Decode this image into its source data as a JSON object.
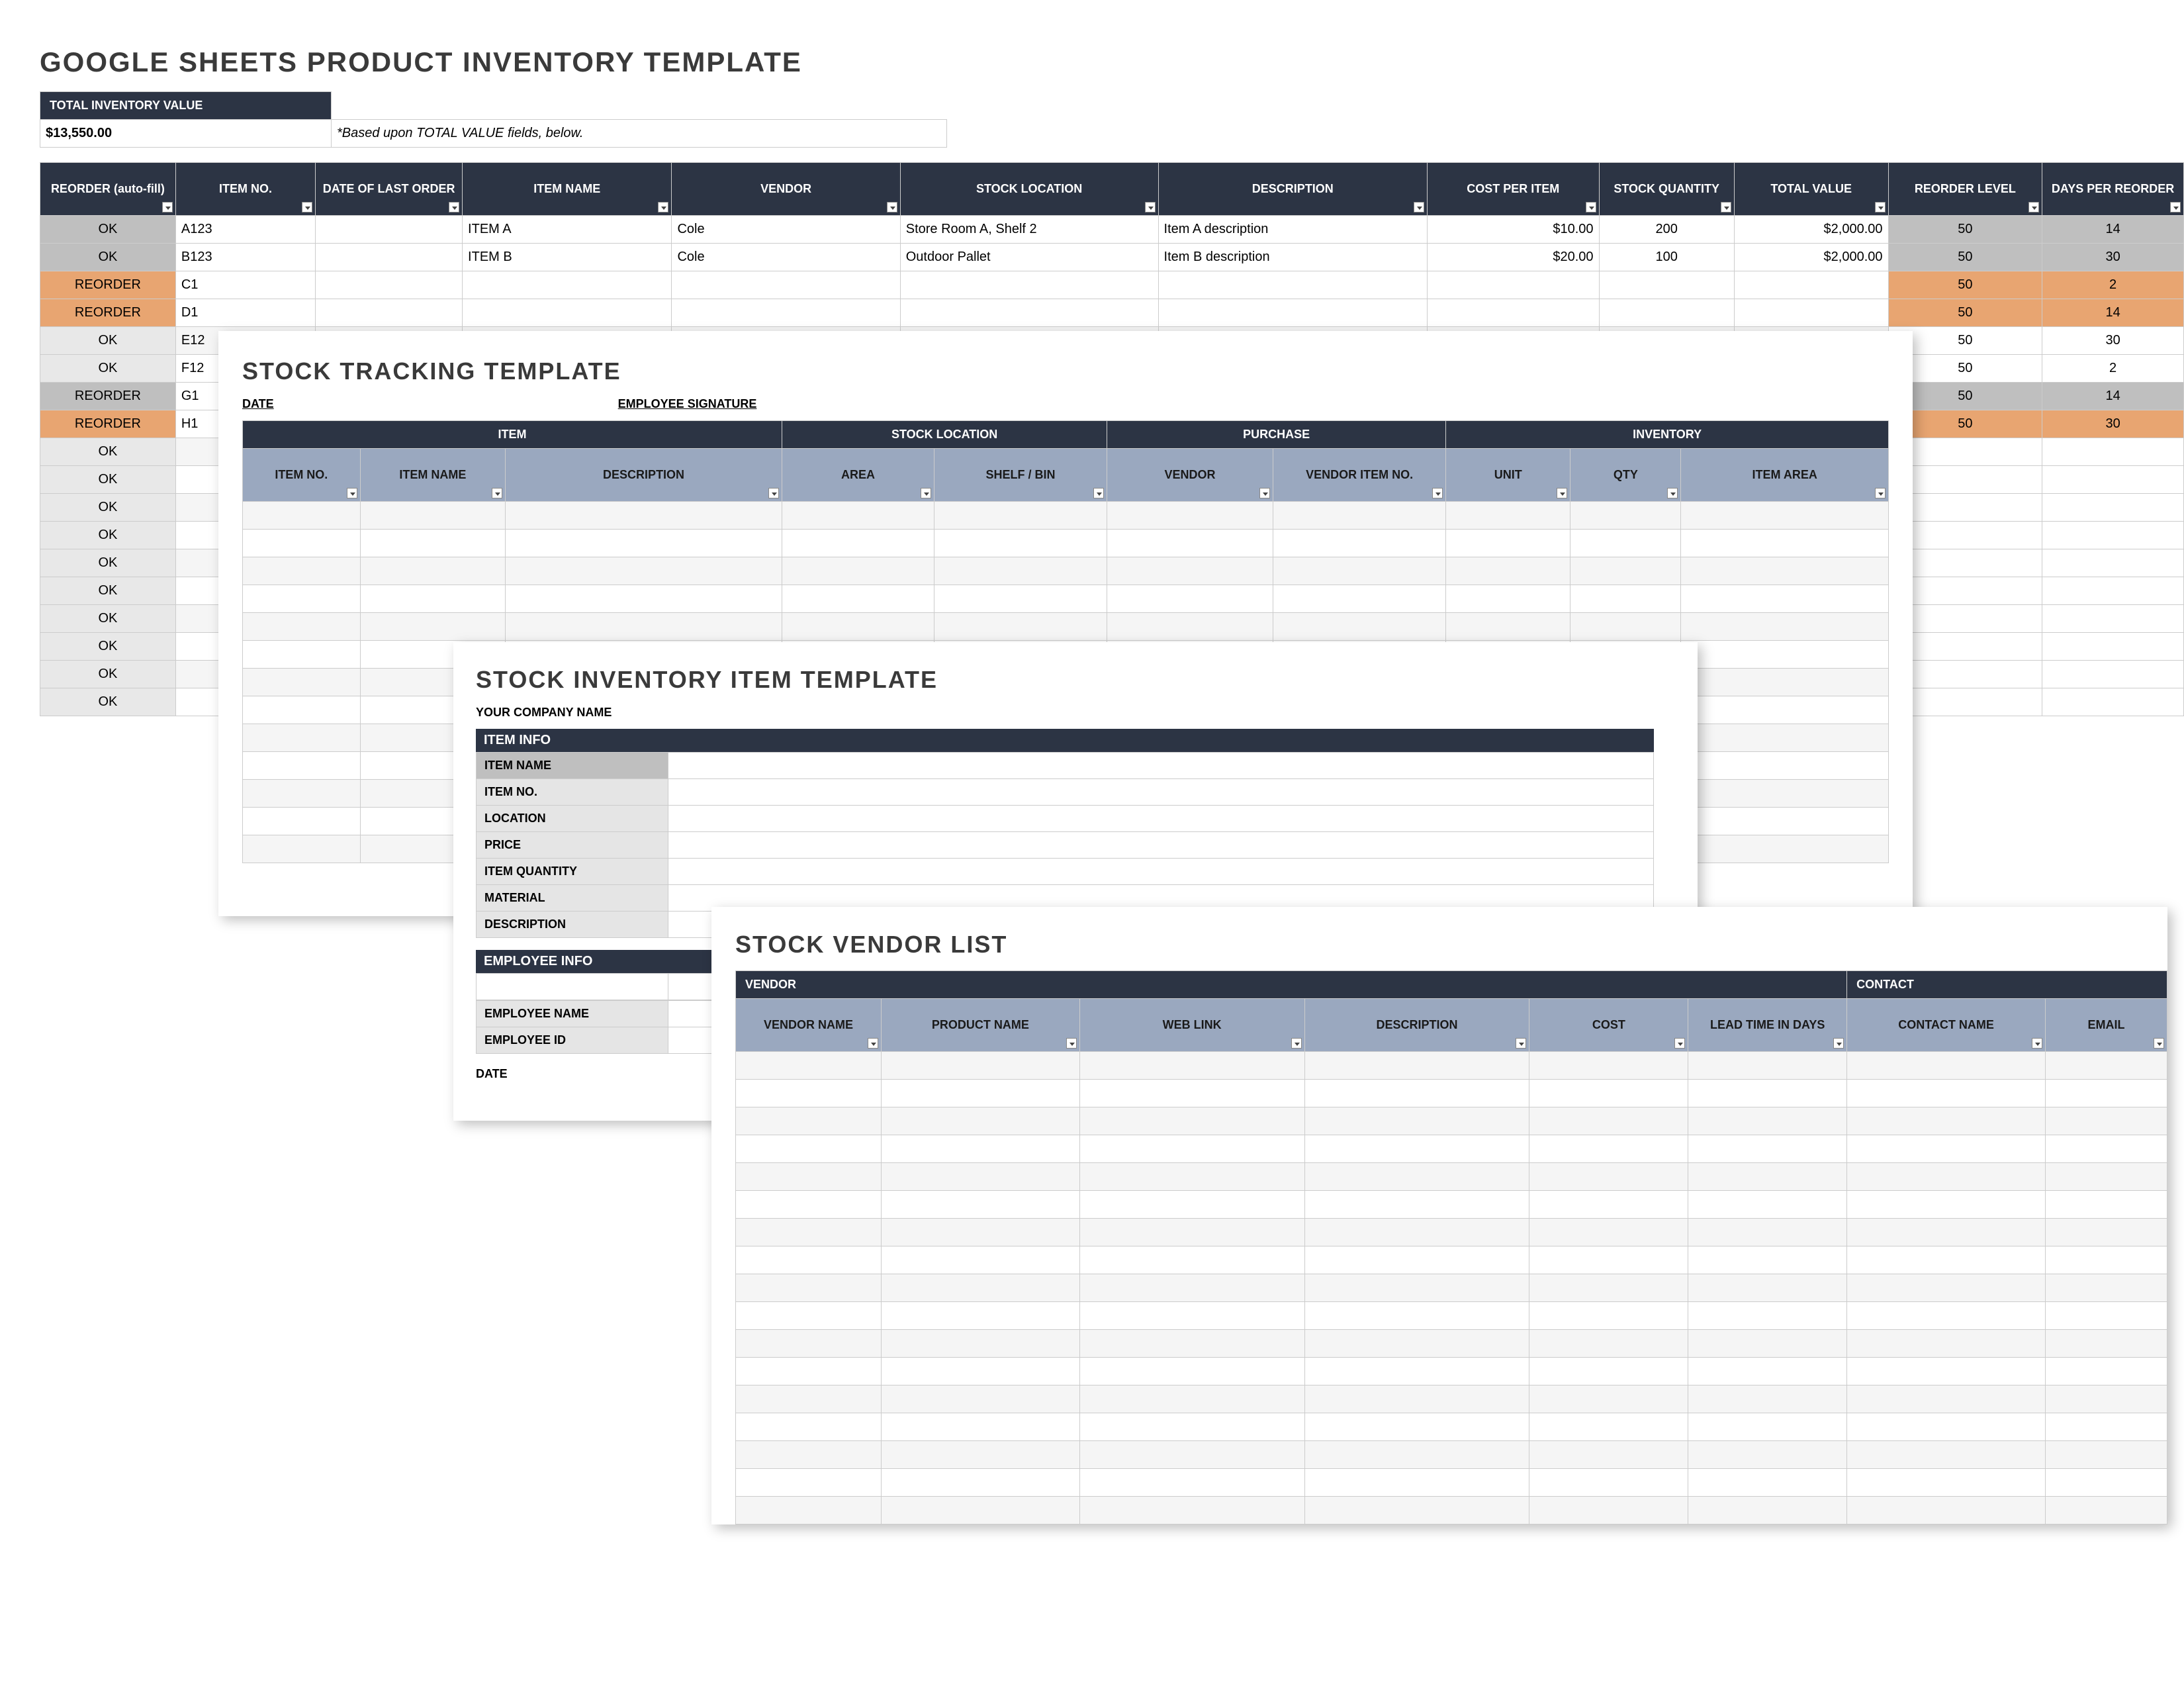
{
  "main": {
    "title": "GOOGLE SHEETS PRODUCT INVENTORY TEMPLATE",
    "inventory_label": "TOTAL INVENTORY VALUE",
    "inventory_value": "$13,550.00",
    "inventory_note": "*Based upon TOTAL VALUE fields, below.",
    "headers": [
      "REORDER (auto-fill)",
      "ITEM NO.",
      "DATE OF LAST ORDER",
      "ITEM NAME",
      "VENDOR",
      "STOCK LOCATION",
      "DESCRIPTION",
      "COST PER ITEM",
      "STOCK QUANTITY",
      "TOTAL VALUE",
      "REORDER LEVEL",
      "DAYS PER REORDER"
    ],
    "rows": [
      {
        "status": "OK",
        "style": "grey",
        "item_no": "A123",
        "item_name": "ITEM A",
        "vendor": "Cole",
        "loc": "Store Room A, Shelf 2",
        "desc": "Item A description",
        "cost": "$10.00",
        "qty": "200",
        "total": "$2,000.00",
        "reorder": "50",
        "days": "14"
      },
      {
        "status": "OK",
        "style": "grey",
        "item_no": "B123",
        "item_name": "ITEM B",
        "vendor": "Cole",
        "loc": "Outdoor Pallet",
        "desc": "Item B description",
        "cost": "$20.00",
        "qty": "100",
        "total": "$2,000.00",
        "reorder": "50",
        "days": "30"
      },
      {
        "status": "REORDER",
        "style": "orange",
        "item_no": "C1",
        "reorder": "50",
        "days": "2"
      },
      {
        "status": "REORDER",
        "style": "orange",
        "item_no": "D1",
        "reorder": "50",
        "days": "14"
      },
      {
        "status": "OK",
        "style": "light",
        "item_no": "E12",
        "reorder": "50",
        "days": "30"
      },
      {
        "status": "OK",
        "style": "light",
        "item_no": "F12",
        "reorder": "50",
        "days": "2"
      },
      {
        "status": "REORDER",
        "style": "grey",
        "item_no": "G1",
        "reorder": "50",
        "days": "14"
      },
      {
        "status": "REORDER",
        "style": "orange",
        "item_no": "H1",
        "reorder": "50",
        "days": "30"
      },
      {
        "status": "OK",
        "style": "light"
      },
      {
        "status": "OK",
        "style": "light"
      },
      {
        "status": "OK",
        "style": "light"
      },
      {
        "status": "OK",
        "style": "light"
      },
      {
        "status": "OK",
        "style": "light"
      },
      {
        "status": "OK",
        "style": "light"
      },
      {
        "status": "OK",
        "style": "light"
      },
      {
        "status": "OK",
        "style": "light"
      },
      {
        "status": "OK",
        "style": "light"
      },
      {
        "status": "OK",
        "style": "light"
      }
    ]
  },
  "tracking": {
    "title": "STOCK TRACKING TEMPLATE",
    "date_label": "DATE",
    "sig_label": "EMPLOYEE SIGNATURE",
    "groups": [
      "ITEM",
      "STOCK LOCATION",
      "PURCHASE",
      "INVENTORY"
    ],
    "headers": [
      "ITEM NO.",
      "ITEM NAME",
      "DESCRIPTION",
      "AREA",
      "SHELF / BIN",
      "VENDOR",
      "VENDOR ITEM NO.",
      "UNIT",
      "QTY",
      "ITEM AREA"
    ]
  },
  "item": {
    "title": "STOCK INVENTORY ITEM TEMPLATE",
    "company_label": "YOUR COMPANY NAME",
    "section1": "ITEM INFO",
    "fields1": [
      "ITEM NAME",
      "ITEM NO.",
      "LOCATION",
      "PRICE",
      "ITEM QUANTITY",
      "MATERIAL",
      "DESCRIPTION"
    ],
    "section2": "EMPLOYEE INFO",
    "fields2": [
      "EMPLOYEE NAME",
      "EMPLOYEE ID"
    ],
    "date_label": "DATE"
  },
  "vendor": {
    "title": "STOCK VENDOR LIST",
    "groups": [
      "VENDOR",
      "CONTACT"
    ],
    "headers": [
      "VENDOR NAME",
      "PRODUCT NAME",
      "WEB LINK",
      "DESCRIPTION",
      "COST",
      "LEAD TIME IN DAYS",
      "CONTACT NAME",
      "EMAIL"
    ]
  }
}
